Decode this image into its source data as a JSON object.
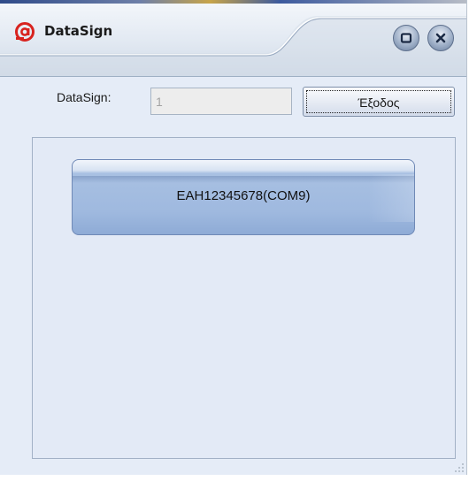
{
  "window": {
    "title": "DataSign",
    "logo_icon": "at-sign-logo-icon",
    "controls": {
      "restore_icon": "restore-icon",
      "close_icon": "close-icon"
    }
  },
  "form": {
    "datasign_label": "DataSign:",
    "datasign_value": "1",
    "exit_label": "Έξοδος"
  },
  "devices": [
    {
      "label": "EAH12345678(COM9)"
    }
  ],
  "colors": {
    "accent": "#9fb9df",
    "logo_red": "#d8231f",
    "client_bg": "#e5ecf7"
  }
}
